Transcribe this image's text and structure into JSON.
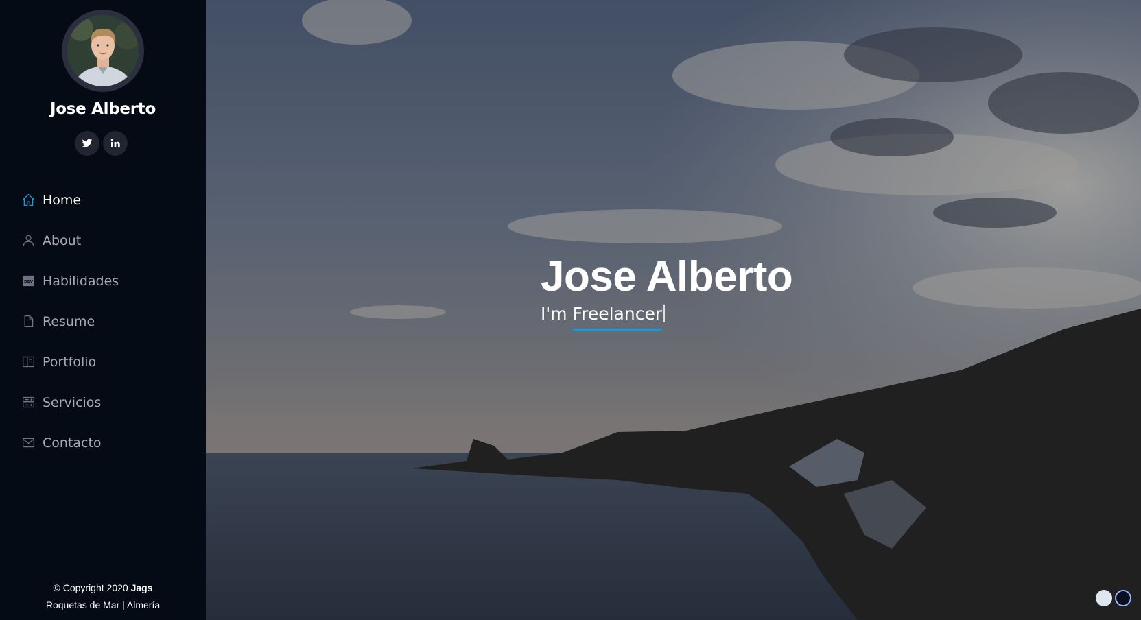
{
  "profile": {
    "name": "Jose Alberto",
    "social": [
      {
        "icon": "twitter-icon"
      },
      {
        "icon": "linkedin-icon"
      }
    ]
  },
  "nav": {
    "items": [
      {
        "label": "Home",
        "icon": "home-icon",
        "active": true
      },
      {
        "label": "About",
        "icon": "person-icon",
        "active": false
      },
      {
        "label": "Habilidades",
        "icon": "dev-icon",
        "active": false
      },
      {
        "label": "Resume",
        "icon": "file-icon",
        "active": false
      },
      {
        "label": "Portfolio",
        "icon": "book-icon",
        "active": false
      },
      {
        "label": "Servicios",
        "icon": "server-icon",
        "active": false
      },
      {
        "label": "Contacto",
        "icon": "envelope-icon",
        "active": false
      }
    ]
  },
  "footer": {
    "copyright_prefix": "© Copyright 2020",
    "brand": "Jags",
    "location": "Roquetas de Mar | Almería"
  },
  "hero": {
    "title": "Jose Alberto",
    "sub_prefix": "I'm",
    "typed": "Freelancer"
  },
  "colors": {
    "accent": "#149ddd",
    "sidebar_bg": "#040b14"
  }
}
